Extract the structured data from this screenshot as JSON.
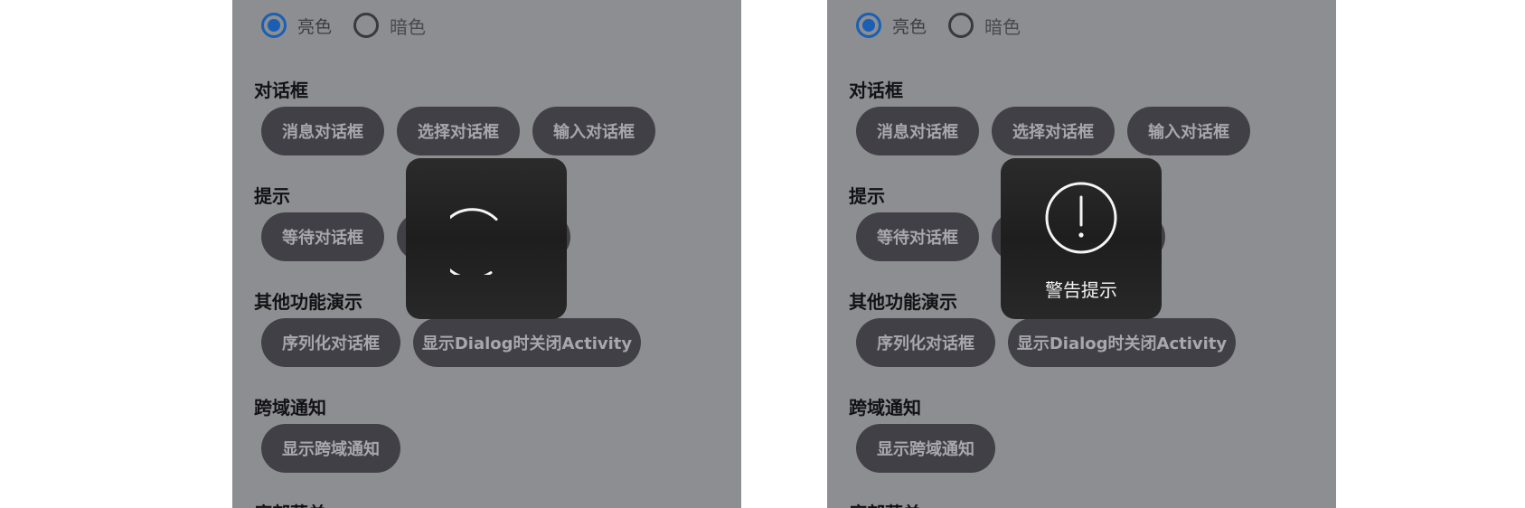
{
  "theme": {
    "light_label": "亮色",
    "dark_label": "暗色",
    "selected": "亮色"
  },
  "sections": {
    "dialog": {
      "title": "对话框",
      "buttons": [
        "消息对话框",
        "选择对话框",
        "输入对话框"
      ]
    },
    "tips": {
      "title": "提示",
      "buttons": [
        "等待对话框"
      ]
    },
    "other": {
      "title": "其他功能演示",
      "buttons": [
        "序列化对话框",
        "显示Dialog时关闭Activity"
      ]
    },
    "cross": {
      "title": "跨域通知",
      "buttons": [
        "显示跨域通知"
      ]
    },
    "bottom_menu": {
      "title": "底部菜单"
    }
  },
  "overlays": {
    "loading": {
      "icon": "loading-spinner-icon"
    },
    "warning": {
      "icon": "warning-circle-icon",
      "text": "警告提示"
    }
  },
  "colors": {
    "accent": "#1a5fb4",
    "dim_background": "#8d8e91",
    "chip_bg": "#414046",
    "chip_text": "#a8a7ad",
    "overlay_bg": "#242424"
  }
}
